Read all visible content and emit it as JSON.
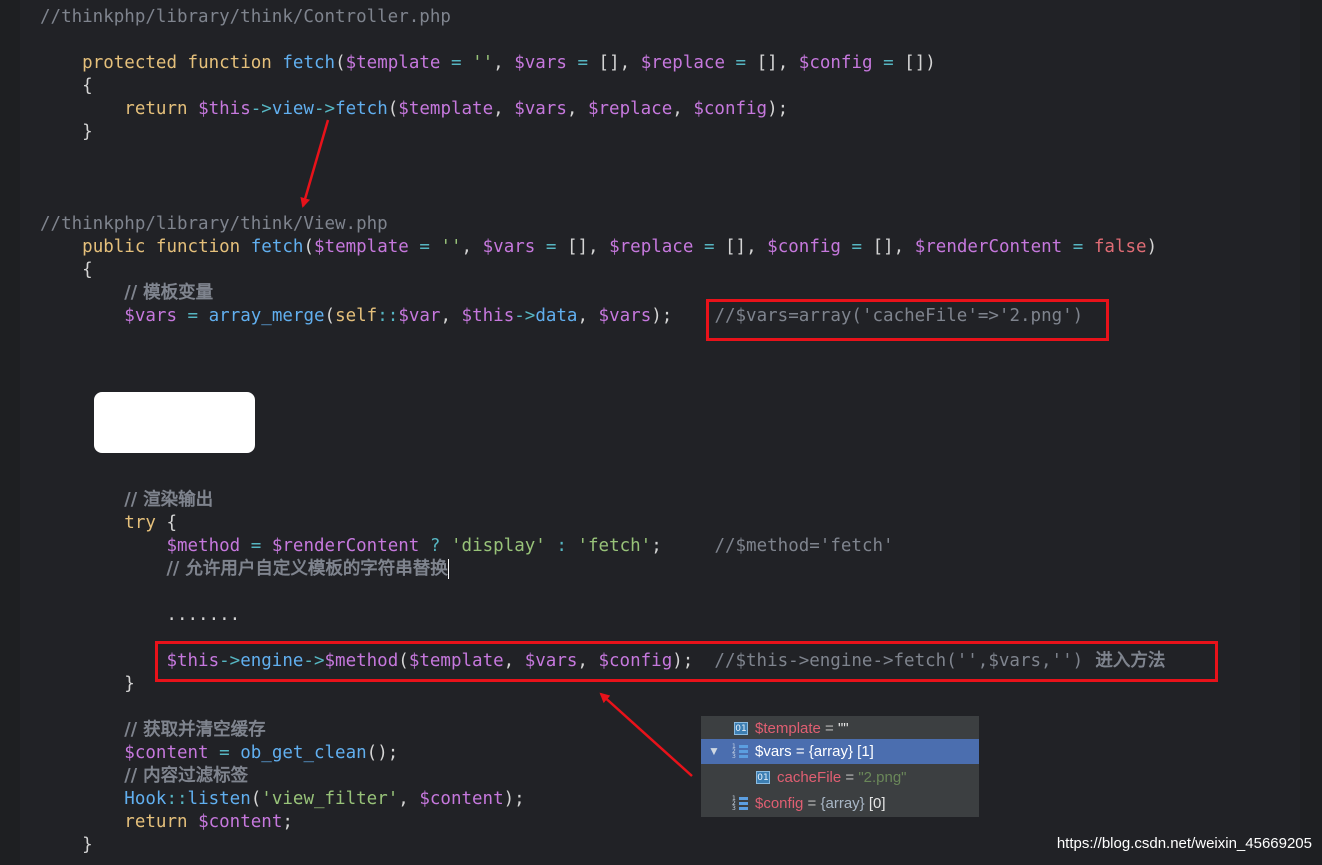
{
  "editor": {
    "lines": [
      {
        "id": "l1",
        "tokens": [
          {
            "t": "//thinkphp/library/think/Controller.php",
            "c": "cm"
          }
        ]
      },
      {
        "id": "l2",
        "tokens": [
          {
            "t": "    "
          },
          {
            "t": "protected",
            "c": "kw"
          },
          {
            "t": " "
          },
          {
            "t": "function",
            "c": "kw"
          },
          {
            "t": " "
          },
          {
            "t": "fetch",
            "c": "fn"
          },
          {
            "t": "("
          },
          {
            "t": "$template",
            "c": "var"
          },
          {
            "t": " "
          },
          {
            "t": "=",
            "c": "op"
          },
          {
            "t": " "
          },
          {
            "t": "''",
            "c": "str"
          },
          {
            "t": ", "
          },
          {
            "t": "$vars",
            "c": "var"
          },
          {
            "t": " "
          },
          {
            "t": "=",
            "c": "op"
          },
          {
            "t": " [], "
          },
          {
            "t": "$replace",
            "c": "var"
          },
          {
            "t": " "
          },
          {
            "t": "=",
            "c": "op"
          },
          {
            "t": " [], "
          },
          {
            "t": "$config",
            "c": "var"
          },
          {
            "t": " "
          },
          {
            "t": "=",
            "c": "op"
          },
          {
            "t": " [])"
          }
        ]
      },
      {
        "id": "l3",
        "tokens": [
          {
            "t": "    {"
          }
        ]
      },
      {
        "id": "l4",
        "tokens": [
          {
            "t": "        "
          },
          {
            "t": "return",
            "c": "kw"
          },
          {
            "t": " "
          },
          {
            "t": "$this",
            "c": "var"
          },
          {
            "t": "->",
            "c": "op"
          },
          {
            "t": "view",
            "c": "fn"
          },
          {
            "t": "->",
            "c": "op"
          },
          {
            "t": "fetch",
            "c": "fn"
          },
          {
            "t": "("
          },
          {
            "t": "$template",
            "c": "var"
          },
          {
            "t": ", "
          },
          {
            "t": "$vars",
            "c": "var"
          },
          {
            "t": ", "
          },
          {
            "t": "$replace",
            "c": "var"
          },
          {
            "t": ", "
          },
          {
            "t": "$config",
            "c": "var"
          },
          {
            "t": ");"
          }
        ]
      },
      {
        "id": "l5",
        "tokens": [
          {
            "t": "    }"
          }
        ]
      },
      {
        "id": "l6",
        "tokens": [
          {
            "t": "//thinkphp/library/think/View.php",
            "c": "cm"
          }
        ]
      },
      {
        "id": "l7",
        "tokens": [
          {
            "t": "    "
          },
          {
            "t": "public",
            "c": "kw"
          },
          {
            "t": " "
          },
          {
            "t": "function",
            "c": "kw"
          },
          {
            "t": " "
          },
          {
            "t": "fetch",
            "c": "fn"
          },
          {
            "t": "("
          },
          {
            "t": "$template",
            "c": "var"
          },
          {
            "t": " "
          },
          {
            "t": "=",
            "c": "op"
          },
          {
            "t": " "
          },
          {
            "t": "''",
            "c": "str"
          },
          {
            "t": ", "
          },
          {
            "t": "$vars",
            "c": "var"
          },
          {
            "t": " "
          },
          {
            "t": "=",
            "c": "op"
          },
          {
            "t": " [], "
          },
          {
            "t": "$replace",
            "c": "var"
          },
          {
            "t": " "
          },
          {
            "t": "=",
            "c": "op"
          },
          {
            "t": " [], "
          },
          {
            "t": "$config",
            "c": "var"
          },
          {
            "t": " "
          },
          {
            "t": "=",
            "c": "op"
          },
          {
            "t": " [], "
          },
          {
            "t": "$renderContent",
            "c": "var"
          },
          {
            "t": " "
          },
          {
            "t": "=",
            "c": "op"
          },
          {
            "t": " "
          },
          {
            "t": "false",
            "c": "bool"
          },
          {
            "t": ")"
          }
        ]
      },
      {
        "id": "l8",
        "tokens": [
          {
            "t": "    {"
          }
        ]
      },
      {
        "id": "l9",
        "tokens": [
          {
            "t": "        "
          },
          {
            "t": "// 模板变量",
            "c": "cmzh"
          }
        ]
      },
      {
        "id": "l10",
        "tokens": [
          {
            "t": "        "
          },
          {
            "t": "$vars",
            "c": "var"
          },
          {
            "t": " "
          },
          {
            "t": "=",
            "c": "op"
          },
          {
            "t": " "
          },
          {
            "t": "array_merge",
            "c": "fn"
          },
          {
            "t": "("
          },
          {
            "t": "self",
            "c": "self"
          },
          {
            "t": "::",
            "c": "op"
          },
          {
            "t": "$var",
            "c": "var"
          },
          {
            "t": ", "
          },
          {
            "t": "$this",
            "c": "var"
          },
          {
            "t": "->",
            "c": "op"
          },
          {
            "t": "data",
            "c": "fn"
          },
          {
            "t": ", "
          },
          {
            "t": "$vars",
            "c": "var"
          },
          {
            "t": ");    "
          },
          {
            "t": "//$vars=array('cacheFile'=>'2.png')",
            "c": "cm"
          }
        ]
      },
      {
        "id": "l11",
        "tokens": [
          {
            "t": "        "
          },
          {
            "t": "// 渲染输出",
            "c": "cmzh"
          }
        ]
      },
      {
        "id": "l12",
        "tokens": [
          {
            "t": "        "
          },
          {
            "t": "try",
            "c": "kw"
          },
          {
            "t": " {"
          }
        ]
      },
      {
        "id": "l13",
        "tokens": [
          {
            "t": "            "
          },
          {
            "t": "$method",
            "c": "var"
          },
          {
            "t": " "
          },
          {
            "t": "=",
            "c": "op"
          },
          {
            "t": " "
          },
          {
            "t": "$renderContent",
            "c": "var"
          },
          {
            "t": " "
          },
          {
            "t": "?",
            "c": "op"
          },
          {
            "t": " "
          },
          {
            "t": "'display'",
            "c": "str"
          },
          {
            "t": " "
          },
          {
            "t": ":",
            "c": "op"
          },
          {
            "t": " "
          },
          {
            "t": "'fetch'",
            "c": "str"
          },
          {
            "t": ";     "
          },
          {
            "t": "//$method='fetch'",
            "c": "cm"
          }
        ]
      },
      {
        "id": "l14",
        "tokens": [
          {
            "t": "            "
          },
          {
            "t": "// 允许用户自定义模板的字符串替换",
            "c": "cmzh"
          }
        ],
        "cursor": true
      },
      {
        "id": "l15",
        "tokens": [
          {
            "t": "            ......."
          }
        ]
      },
      {
        "id": "l16",
        "tokens": [
          {
            "t": "            "
          },
          {
            "t": "$this",
            "c": "var"
          },
          {
            "t": "->",
            "c": "op"
          },
          {
            "t": "engine",
            "c": "fn"
          },
          {
            "t": "->",
            "c": "op"
          },
          {
            "t": "$method",
            "c": "var"
          },
          {
            "t": "("
          },
          {
            "t": "$template",
            "c": "var"
          },
          {
            "t": ", "
          },
          {
            "t": "$vars",
            "c": "var"
          },
          {
            "t": ", "
          },
          {
            "t": "$config",
            "c": "var"
          },
          {
            "t": ");  "
          },
          {
            "t": "//$this->engine->fetch('',$vars,'')",
            "c": "cm"
          },
          {
            "t": "  进入方法",
            "c": "cmzh"
          }
        ]
      },
      {
        "id": "l17",
        "tokens": [
          {
            "t": "        }"
          }
        ]
      },
      {
        "id": "l18",
        "tokens": [
          {
            "t": "        "
          },
          {
            "t": "// 获取并清空缓存",
            "c": "cmzh"
          }
        ]
      },
      {
        "id": "l19",
        "tokens": [
          {
            "t": "        "
          },
          {
            "t": "$content",
            "c": "var"
          },
          {
            "t": " "
          },
          {
            "t": "=",
            "c": "op"
          },
          {
            "t": " "
          },
          {
            "t": "ob_get_clean",
            "c": "fn"
          },
          {
            "t": "();"
          }
        ]
      },
      {
        "id": "l20",
        "tokens": [
          {
            "t": "        "
          },
          {
            "t": "// 内容过滤标签",
            "c": "cmzh"
          }
        ]
      },
      {
        "id": "l21",
        "tokens": [
          {
            "t": "        "
          },
          {
            "t": "Hook",
            "c": "cls"
          },
          {
            "t": "::",
            "c": "op"
          },
          {
            "t": "listen",
            "c": "fn"
          },
          {
            "t": "("
          },
          {
            "t": "'view_filter'",
            "c": "str"
          },
          {
            "t": ", "
          },
          {
            "t": "$content",
            "c": "var"
          },
          {
            "t": ");"
          }
        ]
      },
      {
        "id": "l22",
        "tokens": [
          {
            "t": "        "
          },
          {
            "t": "return",
            "c": "kw"
          },
          {
            "t": " "
          },
          {
            "t": "$content",
            "c": "var"
          },
          {
            "t": ";"
          }
        ]
      },
      {
        "id": "l23",
        "tokens": [
          {
            "t": "    }"
          }
        ]
      }
    ]
  },
  "debugger": {
    "template_name": "$template",
    "template_eq": " = ",
    "template_val": "\"\"",
    "vars_name": "$vars",
    "vars_eq": " = ",
    "vars_type": "{array}",
    "vars_count": "[1]",
    "cachefile_name": "cacheFile",
    "cachefile_eq": " = ",
    "cachefile_val": "\"2.png\"",
    "config_name": "$config",
    "config_eq": " = ",
    "config_type": "{array}",
    "config_count": "[0]",
    "icon_01": "01"
  },
  "watermark": "https://blog.csdn.net/weixin_45669205",
  "colors": {
    "background": "#212226",
    "annotation_red": "#e8121a",
    "debug_selected": "#4b6eaf"
  },
  "icons": [
    "field-01-icon",
    "array-list-icon",
    "expand-triangle-icon"
  ]
}
